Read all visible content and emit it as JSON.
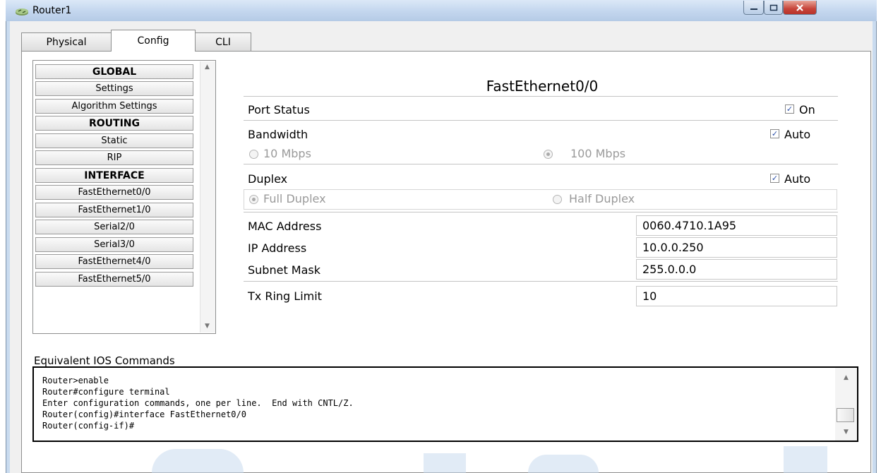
{
  "window": {
    "title": "Router1"
  },
  "tabs": [
    {
      "label": "Physical",
      "active": false
    },
    {
      "label": "Config",
      "active": true
    },
    {
      "label": "CLI",
      "active": false
    }
  ],
  "menu": {
    "items": [
      {
        "label": "GLOBAL",
        "header": true
      },
      {
        "label": "Settings",
        "header": false
      },
      {
        "label": "Algorithm Settings",
        "header": false
      },
      {
        "label": "ROUTING",
        "header": true
      },
      {
        "label": "Static",
        "header": false
      },
      {
        "label": "RIP",
        "header": false
      },
      {
        "label": "INTERFACE",
        "header": true
      },
      {
        "label": "FastEthernet0/0",
        "header": false
      },
      {
        "label": "FastEthernet1/0",
        "header": false
      },
      {
        "label": "Serial2/0",
        "header": false
      },
      {
        "label": "Serial3/0",
        "header": false
      },
      {
        "label": "FastEthernet4/0",
        "header": false
      },
      {
        "label": "FastEthernet5/0",
        "header": false
      }
    ]
  },
  "interface": {
    "title": "FastEthernet0/0",
    "port_status": {
      "label": "Port Status",
      "checkbox_label": "On",
      "checked": true
    },
    "bandwidth": {
      "label": "Bandwidth",
      "checkbox_label": "Auto",
      "checked": true,
      "opt_10": "10 Mbps",
      "opt_100": "100 Mbps",
      "selected": "100 Mbps"
    },
    "duplex": {
      "label": "Duplex",
      "checkbox_label": "Auto",
      "checked": true,
      "opt_full": "Full Duplex",
      "opt_half": "Half Duplex",
      "selected": "Full Duplex"
    },
    "mac": {
      "label": "MAC Address",
      "value": "0060.4710.1A95"
    },
    "ip": {
      "label": "IP Address",
      "value": "10.0.0.250"
    },
    "mask": {
      "label": "Subnet Mask",
      "value": "255.0.0.0"
    },
    "tx": {
      "label": "Tx Ring Limit",
      "value": "10"
    }
  },
  "ios": {
    "label": "Equivalent IOS Commands",
    "lines": "Router>enable\nRouter#configure terminal\nEnter configuration commands, one per line.  End with CNTL/Z.\nRouter(config)#interface FastEthernet0/0\nRouter(config-if)#"
  },
  "icons": {
    "app": "router-icon",
    "minimize": "minimize-icon",
    "maximize": "maximize-icon",
    "close": "close-icon",
    "check": "checkmark-icon",
    "scroll_up": "scroll-up-icon",
    "scroll_down": "scroll-down-icon"
  },
  "colors": {
    "titlebar": "#c3d6ee",
    "close_button": "#c7453a",
    "panel_bg": "#ffffff",
    "checkbox_mark": "#2a4ea8"
  }
}
